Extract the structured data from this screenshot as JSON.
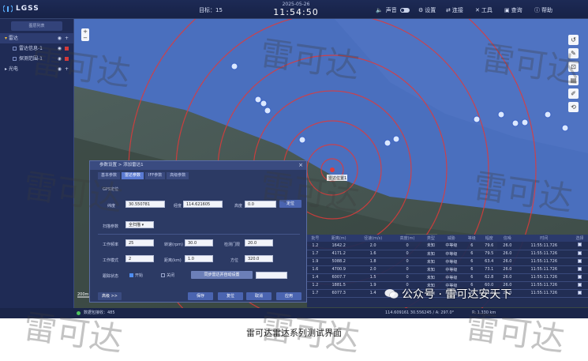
{
  "app": {
    "name": "LGSS"
  },
  "topbar": {
    "target_label": "目标：",
    "target_count": "15",
    "date": "2025-05-26",
    "time": "11:54:50",
    "sound_label": "声音",
    "menu": [
      "设置",
      "连接",
      "工具",
      "查询",
      "帮助"
    ]
  },
  "left_panel": {
    "header": "图层列表",
    "layers": [
      {
        "label": "雷达",
        "level": 0,
        "selected": true
      },
      {
        "label": "雷达信息-1",
        "level": 1,
        "selected": false
      },
      {
        "label": "探测范围-1",
        "level": 1,
        "selected": false
      },
      {
        "label": "光电",
        "level": 0,
        "selected": false
      }
    ]
  },
  "map": {
    "radar_label": "雷达位置1",
    "zoom_plus": "+",
    "zoom_minus": "−",
    "scale": "200m"
  },
  "dialog": {
    "title": "参数设置 > 添加雷达1",
    "close": "×",
    "tabs": [
      "基本参数",
      "雷达参数",
      "IFF参数",
      "高级参数"
    ],
    "active_tab": 1,
    "section_gps": "GPS定位",
    "lat_label": "纬度",
    "lat_value": "30.550781",
    "lon_label": "经度",
    "lon_value": "114.621605",
    "alt_label": "高度",
    "alt_value": "0.0",
    "gps_button": "定位",
    "mode_label": "扫描参数",
    "mode_value": "全扫描",
    "freq_label": "工作频率",
    "freq_value": "25",
    "speed_label": "转速(rpm)",
    "speed_value": "30.0",
    "threshold_label": "检测门限",
    "threshold_value": "20.0",
    "work_mode_label": "工作模式",
    "work_mode_value": "2",
    "range_label": "距离(km)",
    "range_value": "1.0",
    "azimuth_label": "方位",
    "azimuth_value": "320.0",
    "track_label": "跟踪状态",
    "opt_on": "开始",
    "opt_off": "关闭",
    "sync_button": "同步雷达并自动设置",
    "btn_left": "高级 >>",
    "btn_save": "保存",
    "btn_reset": "复位",
    "btn_cancel": "取消",
    "btn_apply": "应用"
  },
  "table": {
    "headers": [
      "批号",
      "距离(m)",
      "径速(m/s)",
      "高度(m)",
      "类型",
      "威胁",
      "等级",
      "幅度",
      "信噪",
      "时间",
      "选择"
    ],
    "rows": [
      [
        "1.2",
        "1642.2",
        "2.0",
        "0",
        "未知",
        "中等级",
        "6",
        "79.6",
        "26.0",
        "11:55:11.726"
      ],
      [
        "1.7",
        "4171.2",
        "1.6",
        "0",
        "未知",
        "中等级",
        "6",
        "79.5",
        "26.0",
        "11:55:11.726"
      ],
      [
        "1.9",
        "5088.2",
        "1.8",
        "0",
        "未知",
        "中等级",
        "6",
        "63.4",
        "26.0",
        "11:55:11.726"
      ],
      [
        "1.6",
        "4700.9",
        "2.0",
        "0",
        "未知",
        "中等级",
        "6",
        "73.1",
        "26.0",
        "11:55:11.726"
      ],
      [
        "1.4",
        "6007.7",
        "1.5",
        "0",
        "未知",
        "中等级",
        "6",
        "62.8",
        "26.0",
        "11:55:11.726"
      ],
      [
        "1.2",
        "1881.5",
        "1.9",
        "0",
        "未知",
        "中等级",
        "6",
        "60.0",
        "26.0",
        "11:55:11.726"
      ],
      [
        "1.7",
        "6077.3",
        "1.4",
        "0",
        "未知",
        "中等级",
        "6",
        "62.0",
        "26.0",
        "11:55:11.726"
      ]
    ]
  },
  "statusbar": {
    "status": "数据包接收：485",
    "coords": "114.609161  30.556245 / A: 297.0°",
    "range": "R: 1.330 km"
  },
  "watermark": "雷可达",
  "wechat_text": "公众号 · 雷可达安天下",
  "caption": "雷可达雷达系列测试界面",
  "colors": {
    "accent": "#4f8df0",
    "ring": "#e03a3a",
    "coverage": "#3f6ed8"
  }
}
